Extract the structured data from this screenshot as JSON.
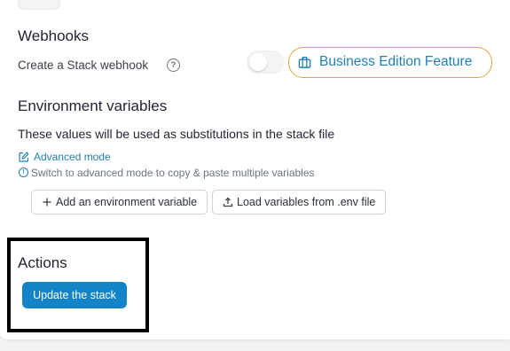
{
  "webhooks": {
    "title": "Webhooks",
    "create_label": "Create a Stack webhook",
    "help_icon": "?",
    "toggle_on": false,
    "business_badge_label": "Business Edition Feature"
  },
  "env": {
    "title": "Environment variables",
    "description": "These values will be used as substitutions in the stack file",
    "advanced_mode_label": "Advanced mode",
    "advanced_hint": "Switch to advanced mode to copy & paste multiple variables",
    "info_icon": "!",
    "add_button_label": "Add an environment variable",
    "load_button_label": "Load variables from .env file"
  },
  "actions": {
    "title": "Actions",
    "update_button_label": "Update the stack"
  },
  "colors": {
    "accent": "#1284c7",
    "link": "#1f7fb5",
    "badge_border": "#e2a33a",
    "highlight": "#000000"
  }
}
